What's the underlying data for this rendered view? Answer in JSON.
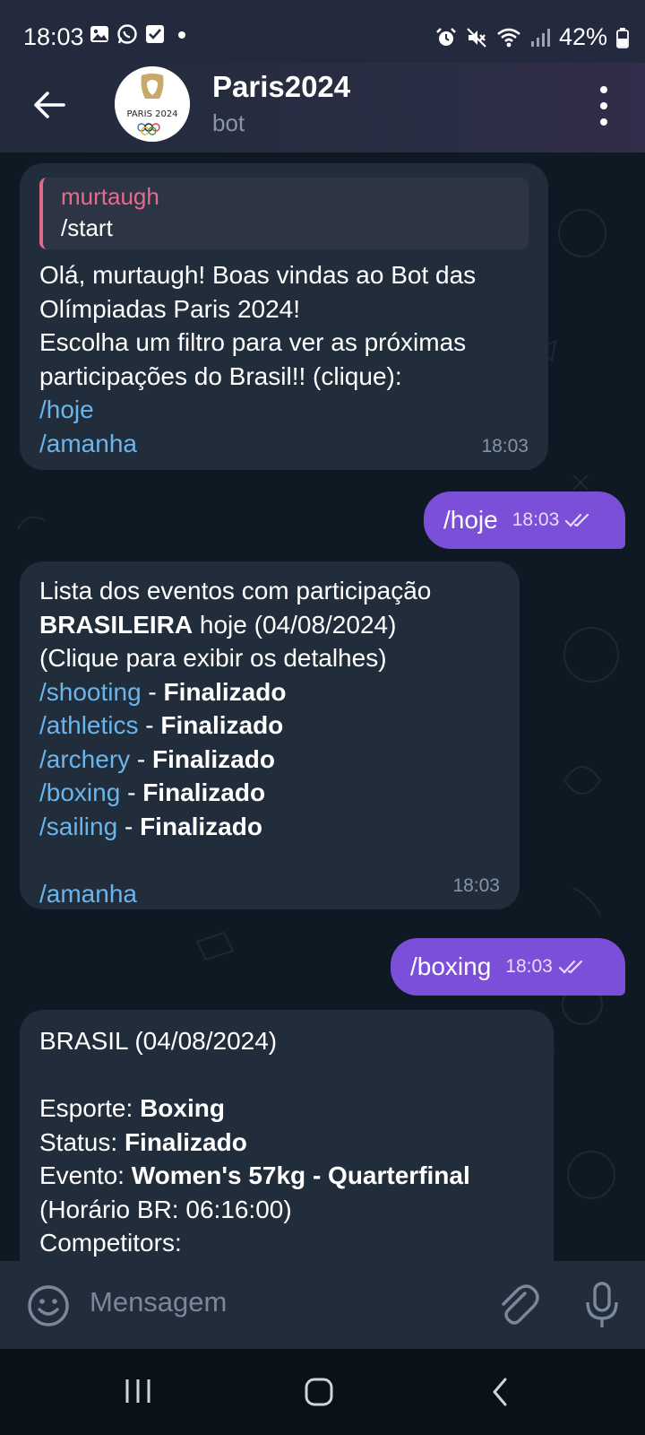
{
  "status_bar": {
    "time": "18:03",
    "battery": "42%"
  },
  "header": {
    "title": "Paris2024",
    "subtitle": "bot",
    "avatar_text": "PARIS 2024"
  },
  "messages": {
    "m1": {
      "reply_name": "murtaugh",
      "reply_text": "/start",
      "line1": "Olá, murtaugh! Boas vindas ao Bot das",
      "line2": "Olímpiadas Paris 2024!",
      "line3": "Escolha um filtro para ver as próximas",
      "line4": "participações do Brasil!! (clique):",
      "cmd1": "/hoje",
      "cmd2": "/amanha",
      "time": "18:03"
    },
    "m2": {
      "text": "/hoje",
      "time": "18:03"
    },
    "m3": {
      "line1": "Lista dos eventos com participação",
      "line2_bold": "BRASILEIRA",
      "line2_rest": " hoje (04/08/2024)",
      "line3": "(Clique para exibir os detalhes)",
      "events": [
        {
          "cmd": "/shooting",
          "sep": " - ",
          "status": "Finalizado"
        },
        {
          "cmd": "/athletics",
          "sep": " - ",
          "status": "Finalizado"
        },
        {
          "cmd": "/archery",
          "sep": " - ",
          "status": "Finalizado"
        },
        {
          "cmd": "/boxing",
          "sep": " - ",
          "status": "Finalizado"
        },
        {
          "cmd": "/sailing",
          "sep": " - ",
          "status": "Finalizado"
        }
      ],
      "cmd_tomorrow": "/amanha",
      "time": "18:03"
    },
    "m4": {
      "text": "/boxing",
      "time": "18:03"
    },
    "m5": {
      "line1": "BRASIL (04/08/2024)",
      "sport_label": "Esporte: ",
      "sport_value": "Boxing",
      "status_label": "Status: ",
      "status_value": "Finalizado",
      "event_label": "Evento: ",
      "event_value": "Women's 57kg - Quarterfinal",
      "schedule": "(Horário BR: 06:16:00)",
      "competitors": "Competitors:"
    }
  },
  "composer": {
    "placeholder": "Mensagem"
  },
  "colors": {
    "header_bg": "#232a3d",
    "chat_bg": "#0f1923",
    "incoming_bubble": "#212d3b",
    "outgoing_bubble": "#7b4fd8",
    "link": "#6bb4ec",
    "reply_name": "#e66b8f"
  },
  "icons": {
    "status_left": [
      "image-icon",
      "whatsapp-icon",
      "checkbox-icon",
      "dot-icon"
    ],
    "status_right": [
      "alarm-icon",
      "mute-icon",
      "wifi-icon",
      "signal-icon",
      "battery-icon"
    ],
    "header": [
      "back-arrow-icon",
      "more-vertical-icon"
    ],
    "composer": [
      "emoji-icon",
      "attach-icon",
      "mic-icon"
    ],
    "nav": [
      "recents-icon",
      "home-icon",
      "back-icon"
    ]
  }
}
